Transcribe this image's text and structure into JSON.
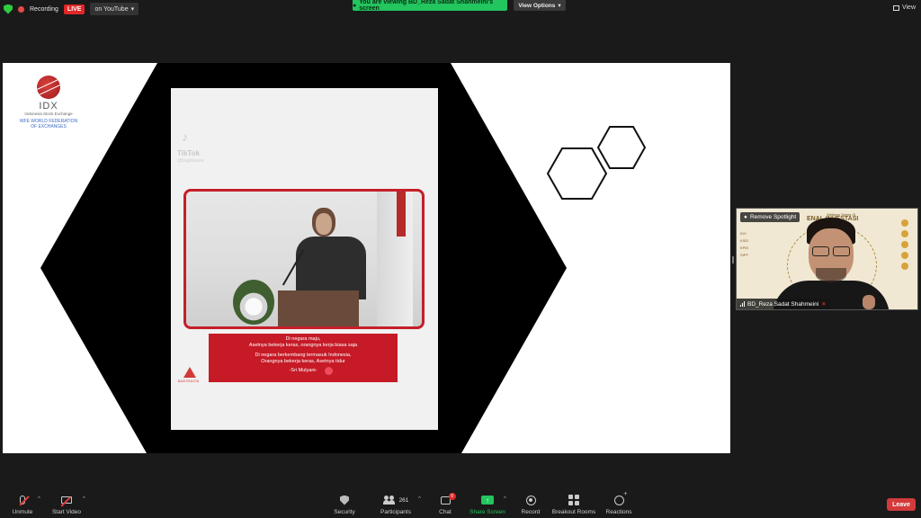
{
  "topbar": {
    "recording_label": "Recording",
    "live_label": "LIVE",
    "youtube_label": "on YouTube",
    "viewing_banner": "You are viewing BD_Reza Sadat Shahmeini's screen",
    "view_options_label": "View Options",
    "view_label": "View"
  },
  "slide": {
    "idx_name": "IDX",
    "idx_subtitle": "Indonesia Stock Exchange",
    "idx_wfe": "WFE WORLD FEDERATION OF EXCHANGES",
    "tiktok_name": "TikTok",
    "tiktok_handle": "@bagitikuota",
    "quote": {
      "line1": "Di negara maju,",
      "line2": "Asetnya bekerja keras, orangnya kerja biasa saja",
      "line3": "Di negara berkembang termasuk Indonesia,",
      "line4": "Orangnya bekerja keras, Asetnya tidur",
      "signature": "-Sri Mulyani-"
    },
    "corner_label": "BAGITIKUOTA"
  },
  "spotlight": {
    "remove_label": "Remove Spotlight",
    "participant_name": "BD_Reza Sadat Shahmeini",
    "webinar_series": "Webinar Series III",
    "webinar_heading": "ENAL INVESTASI",
    "left_logos": [
      "IDX",
      "KSEI",
      "KPEI",
      "SIPF"
    ]
  },
  "toolbar": {
    "unmute_label": "Unmute",
    "start_video_label": "Start Video",
    "security_label": "Security",
    "participants_label": "Participants",
    "participants_count": "261",
    "chat_label": "Chat",
    "chat_badge": "9",
    "share_screen_label": "Share Screen",
    "record_label": "Record",
    "breakout_label": "Breakout Rooms",
    "reactions_label": "Reactions",
    "leave_label": "Leave"
  },
  "colors": {
    "live_red": "#e02828",
    "banner_green": "#22c55e",
    "quote_red": "#c61a26",
    "leave_red": "#d33a3a"
  }
}
